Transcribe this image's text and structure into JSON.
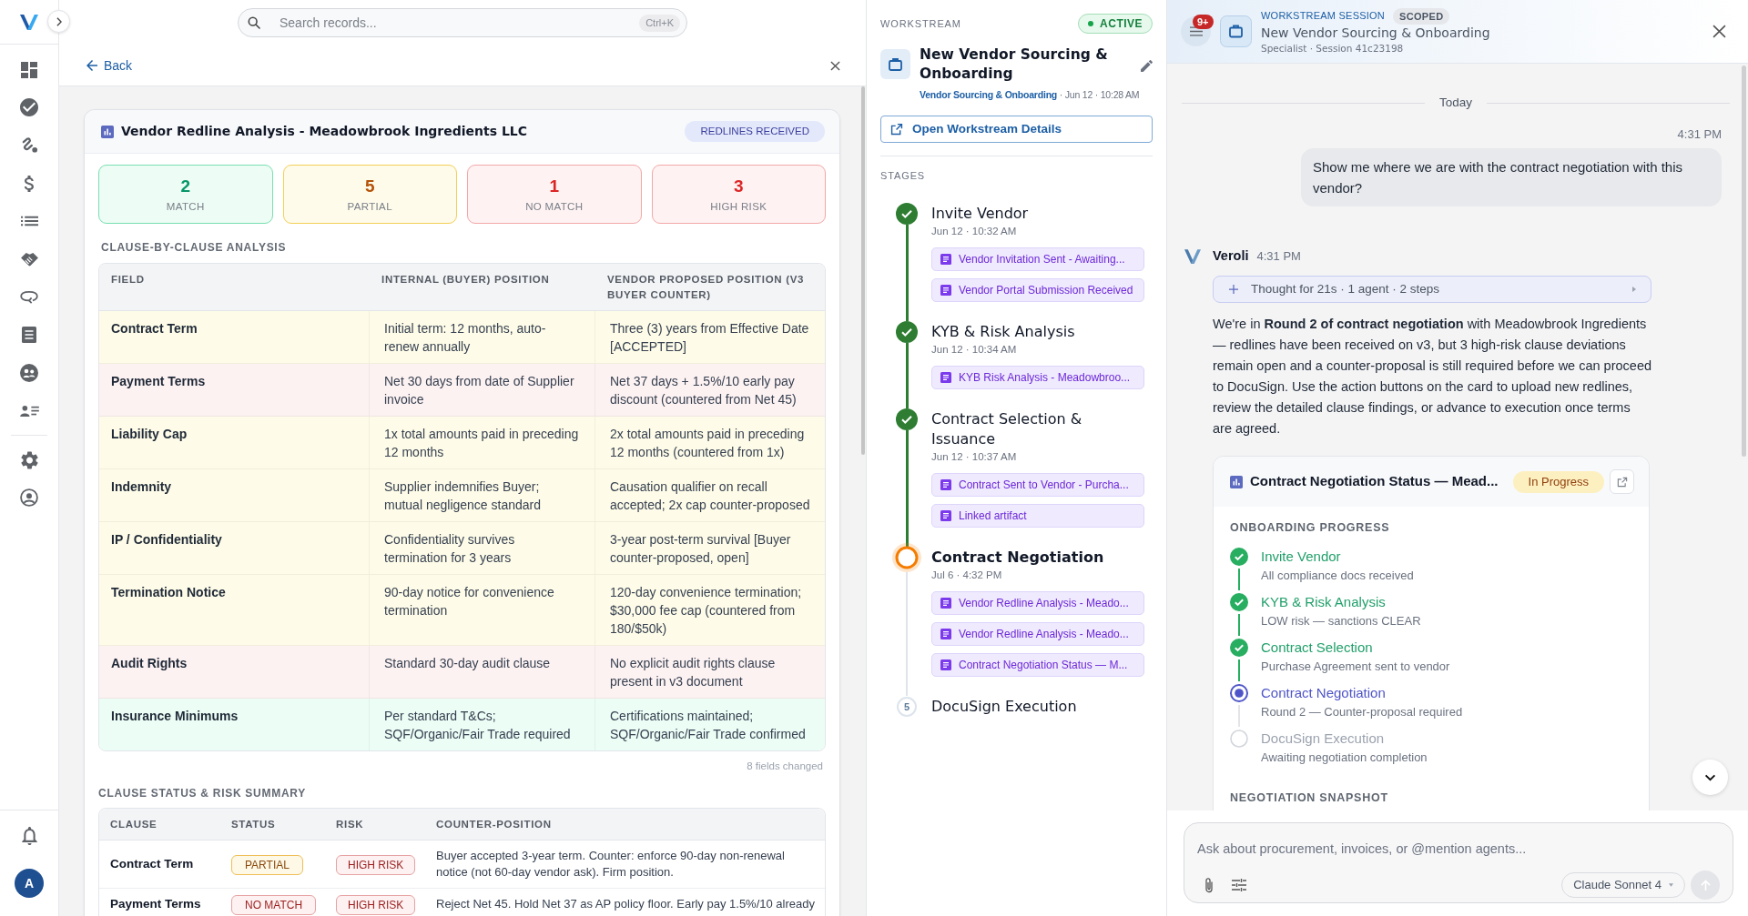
{
  "sidebar": {
    "avatar_initial": "A"
  },
  "search": {
    "placeholder": "Search records...",
    "shortcut": "Ctrl+K"
  },
  "detail": {
    "back_label": "Back",
    "card": {
      "title": "Vendor Redline Analysis - Meadowbrook Ingredients LLC",
      "badge": "REDLINES RECEIVED",
      "stats": [
        {
          "value": "2",
          "label": "MATCH",
          "kind": "match"
        },
        {
          "value": "5",
          "label": "PARTIAL",
          "kind": "partial"
        },
        {
          "value": "1",
          "label": "NO MATCH",
          "kind": "no_match"
        },
        {
          "value": "3",
          "label": "HIGH RISK",
          "kind": "high_risk"
        }
      ],
      "analysis": {
        "heading": "CLAUSE-BY-CLAUSE ANALYSIS",
        "columns": [
          "FIELD",
          "INTERNAL (BUYER) POSITION",
          "VENDOR PROPOSED POSITION (V3 BUYER COUNTER)"
        ],
        "rows": [
          {
            "field": "Contract Term",
            "internal": "Initial term: 12 months, auto-renew annually",
            "vendor": "Three (3) years from Effective Date [ACCEPTED]",
            "color": "#fefce8"
          },
          {
            "field": "Payment Terms",
            "internal": "Net 30 days from date of Supplier invoice",
            "vendor": "Net 37 days + 1.5%/10 early pay discount (countered from Net 45)",
            "color": "#fdf2f2"
          },
          {
            "field": "Liability Cap",
            "internal": "1x total amounts paid in preceding 12 months",
            "vendor": "2x total amounts paid in preceding 12 months (countered from 1x)",
            "color": "#fefce8"
          },
          {
            "field": "Indemnity",
            "internal": "Supplier indemnifies Buyer; mutual negligence standard",
            "vendor": "Causation qualifier on recall accepted; 2x cap counter-proposed",
            "color": "#fefce8"
          },
          {
            "field": "IP / Confidentiality",
            "internal": "Confidentiality survives termination for 3 years",
            "vendor": "3-year post-term survival [Buyer counter-proposed, open]",
            "color": "#fefce8"
          },
          {
            "field": "Termination Notice",
            "internal": "90-day notice for convenience termination",
            "vendor": "120-day convenience termination; $30,000 fee cap (countered from 180/$50k)",
            "color": "#fefce8"
          },
          {
            "field": "Audit Rights",
            "internal": "Standard 30-day audit clause",
            "vendor": "No explicit audit rights clause present in v3 document",
            "color": "#fdf2f2"
          },
          {
            "field": "Insurance Minimums",
            "internal": "Per standard T&Cs; SQF/Organic/Fair Trade required",
            "vendor": "Certifications maintained; SQF/Organic/Fair Trade confirmed",
            "color": "#ecfdf5"
          }
        ],
        "footnote": "8 fields changed"
      },
      "summary": {
        "heading": "CLAUSE STATUS & RISK SUMMARY",
        "columns": [
          "CLAUSE",
          "STATUS",
          "RISK",
          "COUNTER-POSITION"
        ],
        "rows": [
          {
            "clause": "Contract Term",
            "status": {
              "label": "PARTIAL",
              "kind": "partial"
            },
            "risk": {
              "label": "HIGH RISK",
              "kind": "high"
            },
            "counter_position": "Buyer accepted 3-year term. Counter: enforce 90-day non-renewal notice (not 60-day vendor ask). Firm position."
          },
          {
            "clause": "Payment Terms",
            "status": {
              "label": "NO MATCH",
              "kind": "no_match"
            },
            "risk": {
              "label": "HIGH RISK",
              "kind": "high"
            },
            "counter_position": "Reject Net 45. Hold Net 37 as AP policy floor. Early pay 1.5%/10 already"
          }
        ]
      }
    }
  },
  "workstream": {
    "label": "WORKSTREAM",
    "status": {
      "label": "ACTIVE",
      "kind": "active"
    },
    "title": "New Vendor Sourcing & Onboarding",
    "category": "Vendor Sourcing & Onboarding",
    "created": "· Jun 12 · 10:28 AM",
    "open_button": "Open Workstream Details",
    "stages_label": "STAGES",
    "stages": [
      {
        "title": "Invite Vendor",
        "time": "Jun 12 · 10:32 AM",
        "done": true,
        "current": false,
        "artifacts": [
          "Vendor Invitation Sent - Awaiting...",
          "Vendor Portal Submission Received"
        ]
      },
      {
        "title": "KYB & Risk Analysis",
        "time": "Jun 12 · 10:34 AM",
        "done": true,
        "current": false,
        "artifacts": [
          "KYB Risk Analysis - Meadowbroo..."
        ]
      },
      {
        "title": "Contract Selection & Issuance",
        "time": "Jun 12 · 10:37 AM",
        "done": true,
        "current": false,
        "artifacts": [
          "Contract Sent to Vendor - Purcha...",
          "Linked artifact"
        ]
      },
      {
        "title": "Contract Negotiation",
        "time": "Jul 6 · 4:32 PM",
        "done": false,
        "current": true,
        "artifacts": [
          "Vendor Redline Analysis - Meado...",
          "Vendor Redline Analysis - Meado...",
          "Contract Negotiation Status — M..."
        ]
      },
      {
        "title": "DocuSign Execution",
        "done": false,
        "current": false,
        "number": "5"
      }
    ]
  },
  "session": {
    "notification_count": "9+",
    "kicker": "WORKSTREAM SESSION",
    "scope": "SCOPED",
    "title": "New Vendor Sourcing & Onboarding",
    "subtitle": "Specialist · Session 41c23198",
    "date_divider": "Today",
    "messages": [
      {
        "kind": "user",
        "time": "4:31 PM",
        "text": "Show me where we are with the contract negotiation with this vendor?"
      },
      {
        "kind": "assistant",
        "author": "Veroli",
        "time": "4:31 PM",
        "thought": "Thought for 21s · 1 agent · 2 steps",
        "text": "We're in **Round 2 of contract negotiation** with Meadowbrook Ingredients — redlines have been received on v3, but 3 high-risk clause deviations remain open and a counter-proposal is still required before we can proceed to DocuSign. Use the action buttons on the card to upload new redlines, review the detailed clause findings, or advance to execution once terms are agreed.",
        "card": {
          "title": "Contract Negotiation Status — Mead...",
          "status": "In Progress",
          "section": "ONBOARDING PROGRESS",
          "steps": [
            {
              "title": "Invite Vendor",
              "detail": "All compliance docs received",
              "done": true,
              "current": false
            },
            {
              "title": "KYB & Risk Analysis",
              "detail": "LOW risk — sanctions CLEAR",
              "done": true,
              "current": false
            },
            {
              "title": "Contract Selection",
              "detail": "Purchase Agreement sent to vendor",
              "done": true,
              "current": false
            },
            {
              "title": "Contract Negotiation",
              "detail": "Round 2 — Counter-proposal required",
              "done": false,
              "current": true
            },
            {
              "title": "DocuSign Execution",
              "detail": "Awaiting negotiation completion",
              "done": false,
              "current": false
            }
          ],
          "next_section": "NEGOTIATION SNAPSHOT"
        }
      }
    ],
    "composer": {
      "placeholder": "Ask about procurement, invoices, or @mention agents...",
      "model": "Claude Sonnet 4"
    }
  }
}
